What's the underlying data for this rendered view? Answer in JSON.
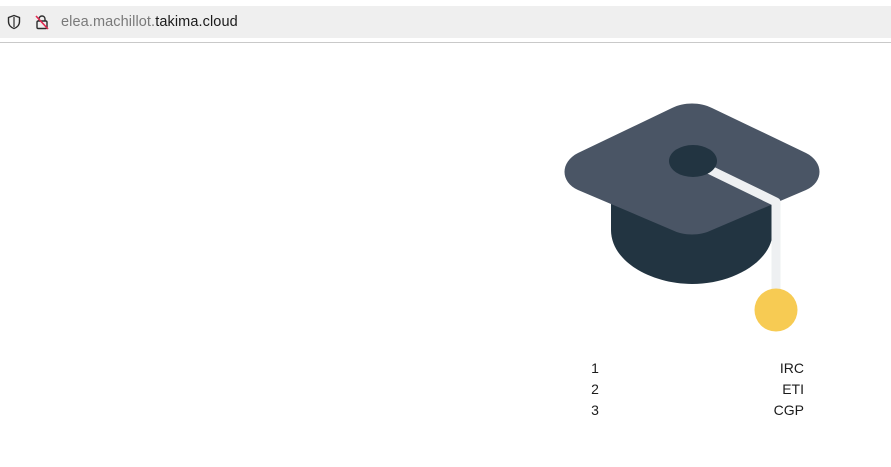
{
  "browser": {
    "url_subdomain": "elea.machillot.",
    "url_domain": "takima.cloud",
    "icons": [
      "shield-icon",
      "lock-slash-icon"
    ]
  },
  "hero": {
    "icon": "graduation-cap-icon",
    "colors": {
      "board": "#4a5565",
      "crown": "#223441",
      "button": "#223441",
      "cord": "#eef0f2",
      "tassel": "#f7cb53"
    }
  },
  "schools": [
    {
      "rank": "1",
      "name": "IRC"
    },
    {
      "rank": "2",
      "name": "ETI"
    },
    {
      "rank": "3",
      "name": "CGP"
    }
  ]
}
